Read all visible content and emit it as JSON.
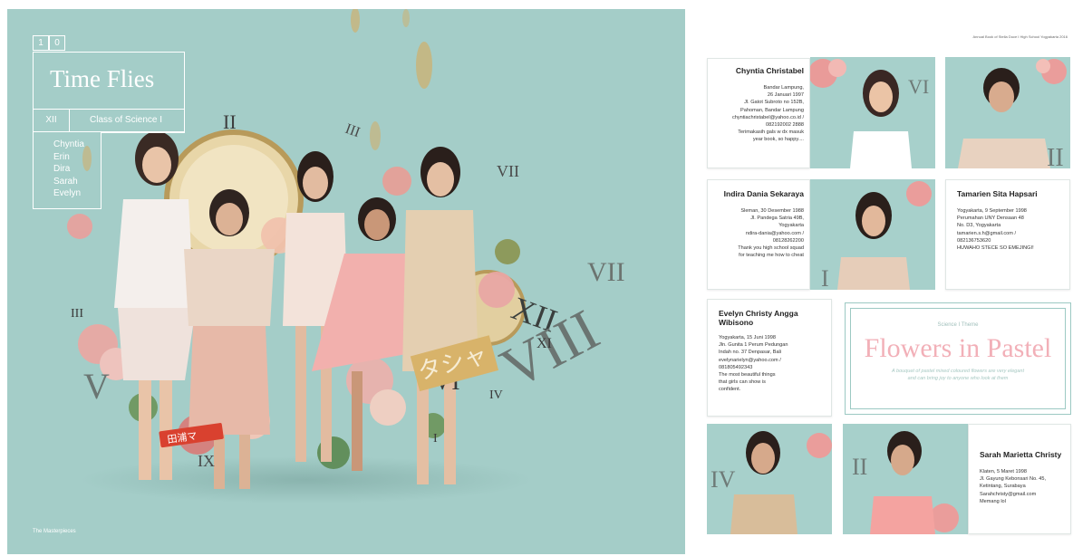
{
  "left_page": {
    "page_number_digits": [
      "1",
      "0"
    ],
    "title": "Time Flies",
    "year_label": "XII",
    "class_label": "Class of Science I",
    "names": [
      "Chyntia",
      "Erin",
      "Dira",
      "Sarah",
      "Evelyn"
    ],
    "footer": "The Masterpieces",
    "roman_numerals": [
      "I",
      "II",
      "III",
      "VII",
      "VII",
      "XII",
      "VIII",
      "XI",
      "IX",
      "V",
      "III",
      "IV",
      "VI",
      "I"
    ]
  },
  "right_page": {
    "header": "Annual Book of Stella Duce I High School Yogyakarta 2016",
    "profiles": [
      {
        "name": "Chyntia Christabel",
        "lines": [
          "Bandar Lampung,",
          "26 Januari 1997",
          "Jl. Gatot Subroto no 152B,",
          "Pahoman, Bandar Lampung",
          "chyntiachristabel@yahoo.co.id /",
          "082192002 2888",
          "Terimakasih gals w dx masuk",
          "year book, so happy...."
        ]
      },
      {
        "name": "Indira Dania Sekaraya",
        "lines": [
          "Sleman, 30 Desember 1988",
          "Jl. Pandega Satria 49B,",
          "Yogyakarta",
          "ndira-dania@yahoo.com /",
          "08128262200",
          "Thank you high school squad",
          "for teaching me how to cheat"
        ]
      },
      {
        "name": "Tamarien Sita Hapsari",
        "lines": [
          "Yogyakarta, 9 September 1998",
          "Perumahan UNY Densaan 48",
          "No. D3, Yogyakarta",
          "tamarien.s.h@gmail.com /",
          "082136753620",
          "HUWAHO STECE SO EMEJINGI!"
        ]
      },
      {
        "name": "Evelyn Christy Angga Wibisono",
        "lines": [
          "Yogyakarta, 15 Juni 1998",
          "Jln. Gunita 1 Perum Pedungan",
          "Indah no. 37 Denpasar, Bali",
          "evelynarielyn@yahoo.com /",
          "081805492343",
          "The most beautiful things",
          "that girls can show is",
          "confident."
        ]
      },
      {
        "name": "Sarah Marietta Christy",
        "lines": [
          "Klaten, 5 Maret 1998",
          "Jl. Gayung Kebonsari No. 45,",
          "Ketintang, Surabaya",
          "Sarahchristy@gmail.com",
          "Memang lol"
        ]
      }
    ],
    "feature": {
      "subtitle": "Science I Theme",
      "title": "Flowers in Pastel",
      "description": "A bouquet of pastel mixed coloured flowers are very elegant and can bring joy to anyone who look at them"
    }
  },
  "colors": {
    "teal_background": "#a4cdc8",
    "pink_title": "#f2b0b8",
    "text_dark": "#222222"
  }
}
